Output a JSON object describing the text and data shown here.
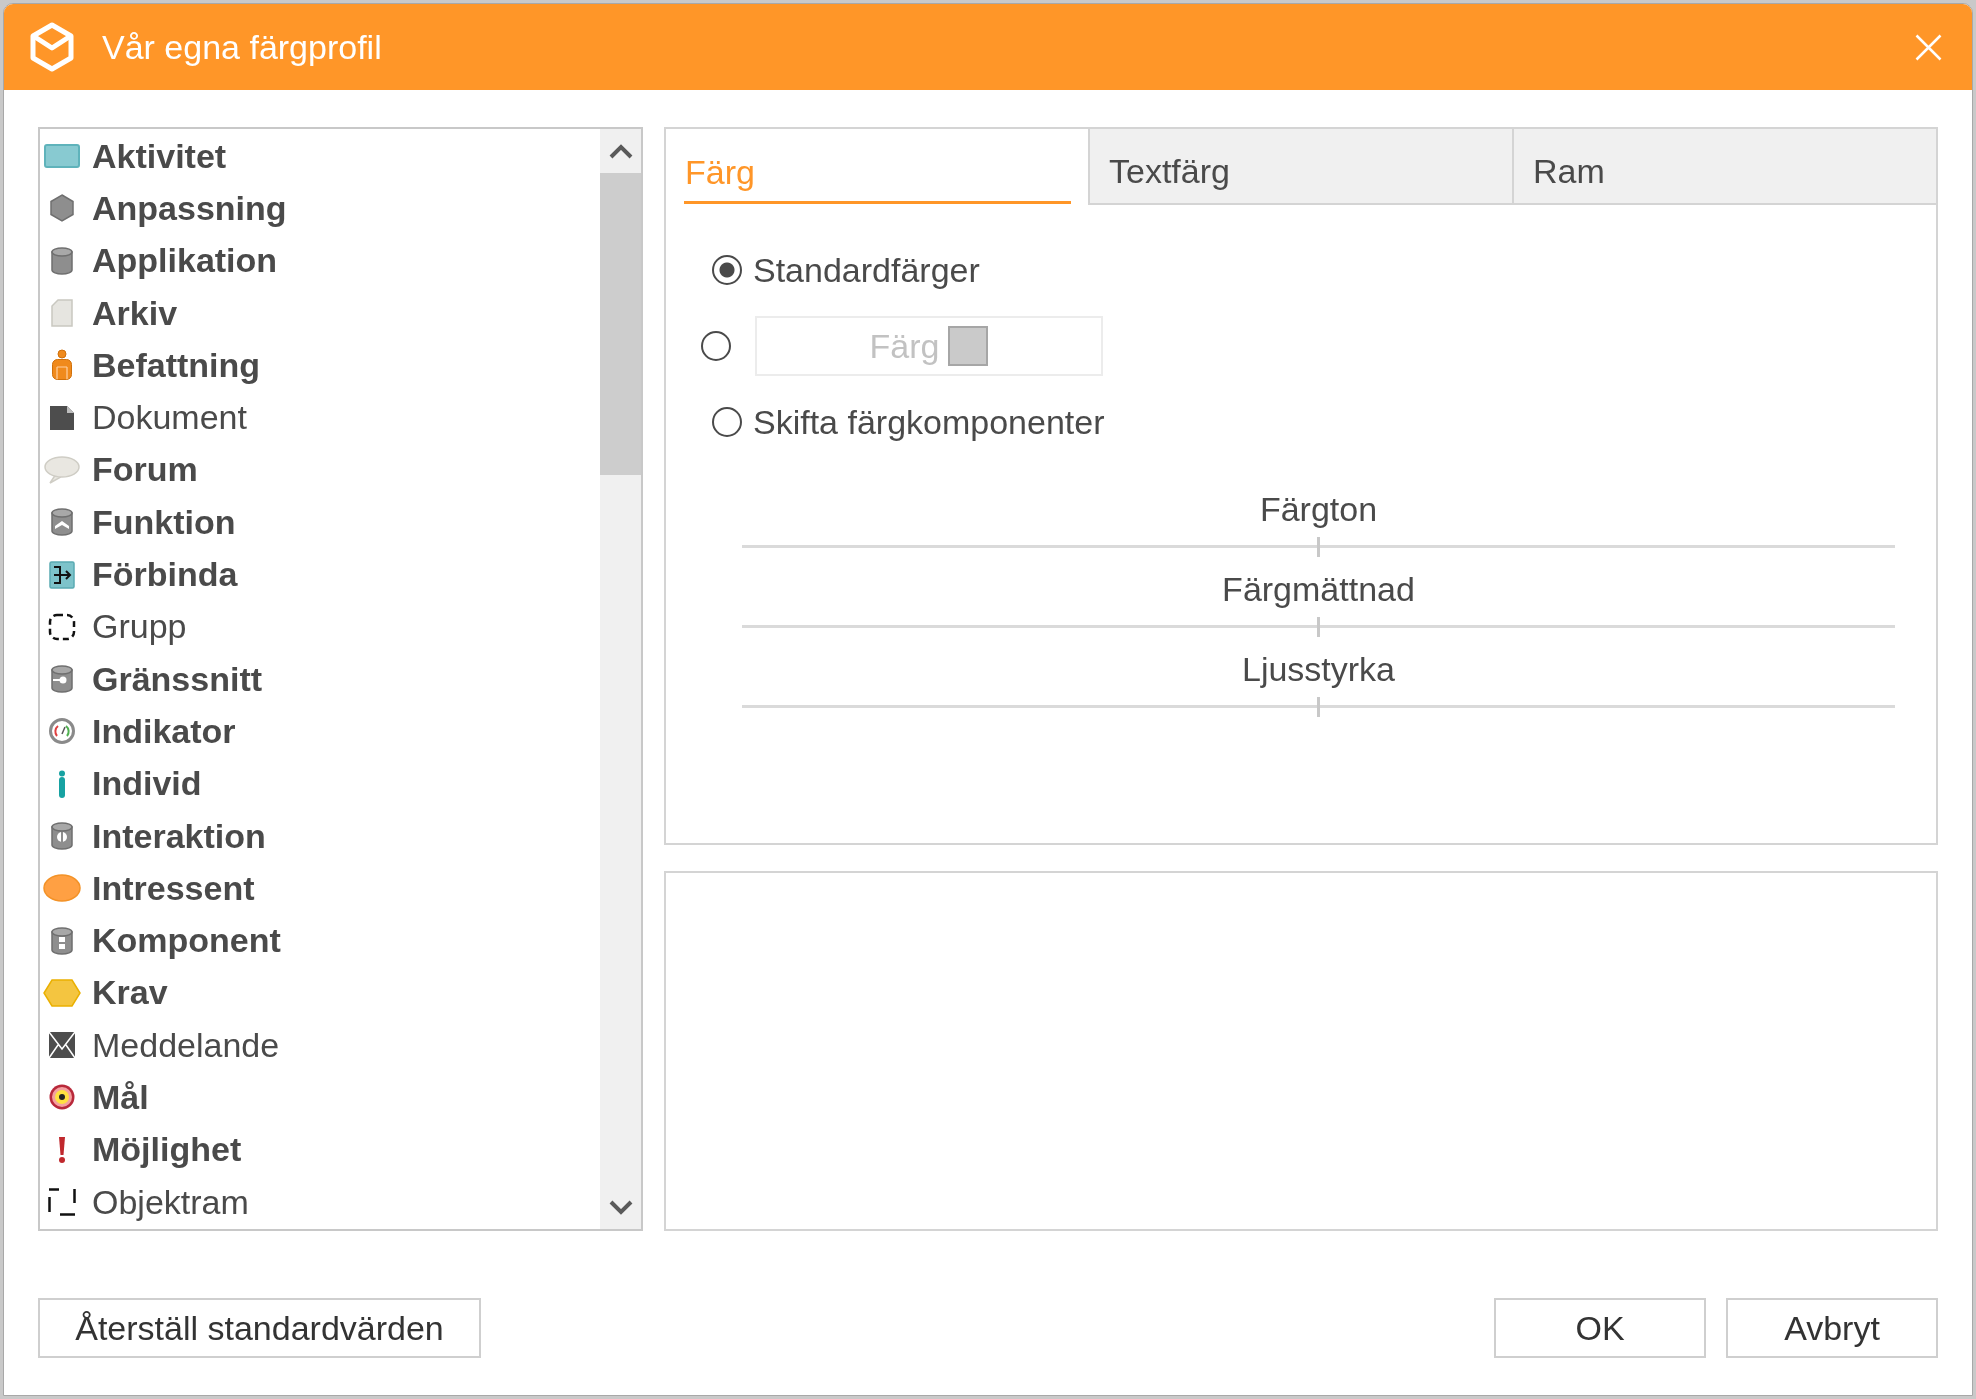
{
  "window": {
    "title": "Vår egna färgprofil"
  },
  "list": {
    "items": [
      {
        "label": "Aktivitet",
        "bold": true,
        "selected": false
      },
      {
        "label": "Anpassning",
        "bold": true,
        "selected": false
      },
      {
        "label": "Applikation",
        "bold": true,
        "selected": false
      },
      {
        "label": "Arkiv",
        "bold": true,
        "selected": false
      },
      {
        "label": "Befattning",
        "bold": true,
        "selected": false
      },
      {
        "label": "Dokument",
        "bold": false,
        "selected": false
      },
      {
        "label": "Forum",
        "bold": true,
        "selected": false
      },
      {
        "label": "Funktion",
        "bold": true,
        "selected": false
      },
      {
        "label": "Förbinda",
        "bold": true,
        "selected": false
      },
      {
        "label": "Grupp",
        "bold": false,
        "selected": false
      },
      {
        "label": "Gränssnitt",
        "bold": true,
        "selected": false
      },
      {
        "label": "Indikator",
        "bold": true,
        "selected": false
      },
      {
        "label": "Individ",
        "bold": true,
        "selected": false
      },
      {
        "label": "Interaktion",
        "bold": true,
        "selected": false
      },
      {
        "label": "Intressent",
        "bold": true,
        "selected": false
      },
      {
        "label": "Komponent",
        "bold": true,
        "selected": false
      },
      {
        "label": "Krav",
        "bold": true,
        "selected": false
      },
      {
        "label": "Meddelande",
        "bold": false,
        "selected": false
      },
      {
        "label": "Mål",
        "bold": true,
        "selected": false
      },
      {
        "label": "Möjlighet",
        "bold": true,
        "selected": false
      },
      {
        "label": "Objektram",
        "bold": false,
        "selected": false
      }
    ]
  },
  "tabs": [
    {
      "label": "Färg",
      "selected": true
    },
    {
      "label": "Textfärg",
      "selected": false
    },
    {
      "label": "Ram",
      "selected": false
    }
  ],
  "color_options": [
    {
      "kind": "label",
      "label": "Standardfärger",
      "selected": true
    },
    {
      "kind": "color_button",
      "button": {
        "label": "Färg",
        "disabled": true
      },
      "selected": false
    },
    {
      "kind": "label",
      "label": "Skifta färgkomponenter",
      "selected": false
    }
  ],
  "sliders": [
    {
      "label": "Färgton",
      "level": 0.5
    },
    {
      "label": "Färgmättnad",
      "level": 0.5
    },
    {
      "label": "Ljusstyrka",
      "level": 0.5
    }
  ],
  "buttons_left": [
    "Återställ standardvärden"
  ],
  "buttons_right": [
    "OK",
    "Avbryt"
  ]
}
